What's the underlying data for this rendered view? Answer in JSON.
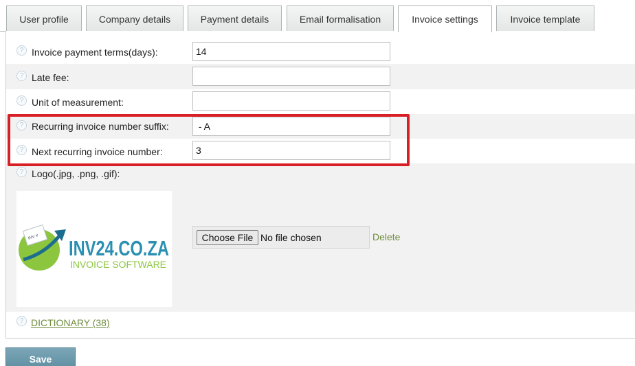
{
  "tabs": [
    {
      "label": "User profile"
    },
    {
      "label": "Company details"
    },
    {
      "label": "Payment details"
    },
    {
      "label": "Email formalisation"
    },
    {
      "label": "Invoice settings",
      "active": true
    },
    {
      "label": "Invoice template"
    }
  ],
  "form": {
    "payment_terms": {
      "label": "Invoice payment terms(days):",
      "value": "14"
    },
    "late_fee": {
      "label": "Late fee:",
      "value": ""
    },
    "unit": {
      "label": "Unit of measurement:",
      "value": ""
    },
    "suffix": {
      "label": "Recurring invoice number suffix:",
      "value": " - A"
    },
    "next_number": {
      "label": "Next recurring invoice number:",
      "value": "3"
    },
    "logo": {
      "label": "Logo(.jpg, .png, .gif):"
    }
  },
  "logo_image": {
    "brand": "INV24.CO.ZA",
    "tagline": "INVOICE SOFTWARE",
    "badge": "INV #"
  },
  "file_input": {
    "button_label": "Choose File",
    "status": "No file chosen"
  },
  "delete_label": "Delete",
  "dictionary_label": "DICTIONARY (38)",
  "save_label": "Save",
  "help_icon_glyph": "?",
  "colors": {
    "highlight": "#d91f26",
    "link": "#6e8c3e",
    "save": "#6a97a8"
  }
}
